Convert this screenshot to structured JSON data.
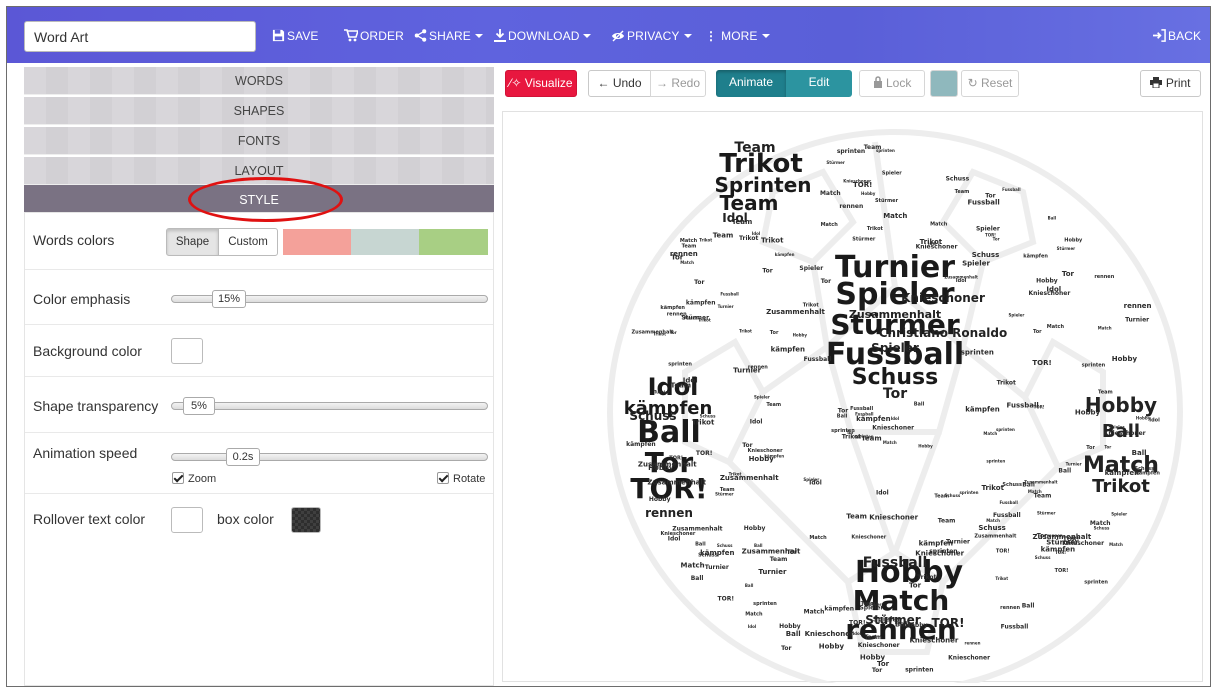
{
  "toolbar": {
    "title_value": "Word Art",
    "save": "SAVE",
    "order": "ORDER",
    "share": "SHARE",
    "download": "DOWNLOAD",
    "privacy": "PRIVACY",
    "more": "MORE",
    "back": "BACK",
    "accent_color": "#5b5fd8"
  },
  "sidebar": {
    "sections": [
      "WORDS",
      "SHAPES",
      "FONTS",
      "LAYOUT",
      "STYLE"
    ],
    "active_section": "STYLE",
    "style": {
      "words_colors": {
        "label": "Words colors",
        "options": [
          "Shape",
          "Custom"
        ],
        "selected": "Shape",
        "palette": [
          "#f4a19a",
          "#c7d6d2",
          "#a8cf84"
        ]
      },
      "color_emphasis": {
        "label": "Color emphasis",
        "value": "15%"
      },
      "background_color": {
        "label": "Background color",
        "color": "#ffffff"
      },
      "shape_transparency": {
        "label": "Shape transparency",
        "value": "5%"
      },
      "animation_speed": {
        "label": "Animation speed",
        "value": "0.2s",
        "zoom_label": "Zoom",
        "rotate_label": "Rotate",
        "zoom_checked": true,
        "rotate_checked": true
      },
      "rollover": {
        "text_color_label": "Rollover text color",
        "box_color_label": "box color",
        "text_color": "#ffffff",
        "box_color": "#333333"
      }
    }
  },
  "canvas_toolbar": {
    "visualize": "Visualize",
    "undo": "Undo",
    "redo": "Redo",
    "animate": "Animate",
    "edit": "Edit",
    "lock": "Lock",
    "reset": "Reset",
    "print": "Print",
    "visualize_color": "#e8173f",
    "mode_color": "#2c94a0",
    "mode_dark_color": "#1f7f8c",
    "color_swatch": "#8fb8bd"
  },
  "word_cloud": {
    "large_words": [
      "Turnier",
      "Spieler",
      "Stürmer",
      "Fussball",
      "Schuss",
      "Idol",
      "kämpfen",
      "Ball",
      "Tor",
      "TOR!",
      "Hobby",
      "Match",
      "rennen",
      "Trikot",
      "Sprinten",
      "Team"
    ],
    "medium_words": [
      "Kniescho­ner",
      "Zusammenhalt",
      "Christiano Ronaldo",
      "Spieler",
      "Tor",
      "Hobby",
      "Ball",
      "Match",
      "Trikot",
      "Fussball",
      "Team",
      "Idol",
      "Schuss",
      "Stürmer",
      "rennen",
      "TOR!"
    ],
    "small_words": [
      "Ball",
      "Team",
      "Tor",
      "Idol",
      "Match",
      "Trikot",
      "Schuss",
      "Hobby",
      "Spieler",
      "TOR!",
      "Turnier",
      "rennen",
      "kämpfen",
      "Stürmer",
      "sprinten",
      "Fussball",
      "Kniescho­ner",
      "Zusammenhalt"
    ]
  }
}
